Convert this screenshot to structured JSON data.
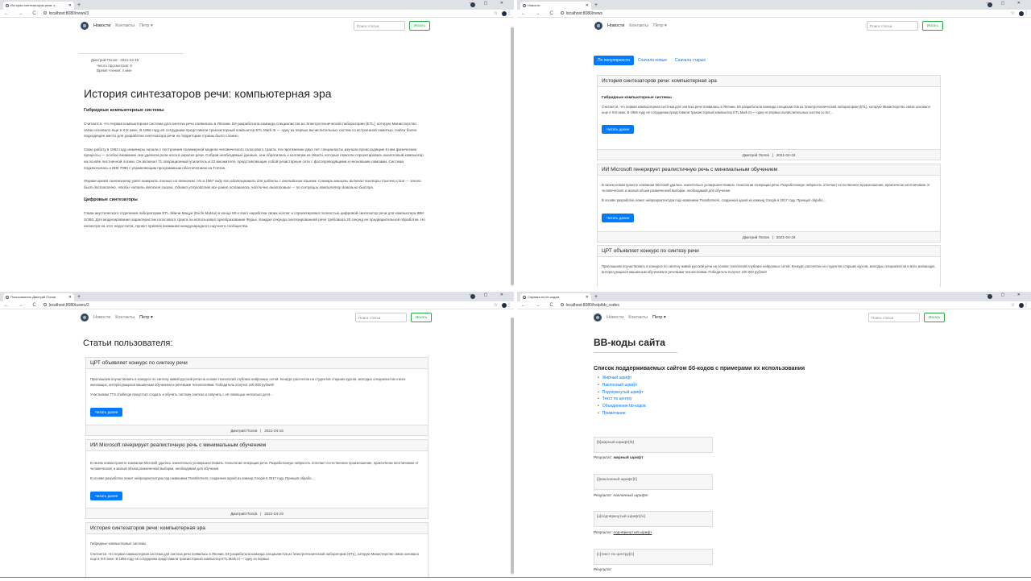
{
  "windows": [
    {
      "tab_title": "История синтезаторов речи: к...",
      "url": "localhost:8080/news/3",
      "nav": {
        "news": "Новости",
        "contacts": "Контакты",
        "user": "Петр ▾"
      },
      "search_placeholder": "Поиск статьи",
      "search_btn": "Искать",
      "meta": {
        "author": "Дмитрий Попов",
        "date": "2021-04-18",
        "views": "Число просмотров: 8",
        "reading": "Время чтения: 4 мин"
      },
      "article": {
        "title": "История синтезаторов речи: компьютерная эра",
        "h1": "Гибридные компьютерные системы",
        "p1": "Считается, что первая компьютерная система для синтеза речи появилась в Японии. Её разработала команда специалистов из Электротехнической лаборатории (ETL), которую Министерство связи основало еще в XIX веке. В 1956 году её сотрудники представили транзисторный компьютер ETL Mark III — одну из первых вычислительных систем со встроенной памятью. Найти более подходящее место для разработки синтезатора речи на территории страны было сложно.",
        "p2": "Свою работу в 1963 году инженеры начали с построения полимерной модели человеческого голосового тракта. На протяжении двух лет специалисты изучали происходящие в нем физические процессы — особое внимание они уделили роли носа в окраске речи. Собрав необходимые данные, они обратились к коллегам из Hitachi, которые помогли спроектировать аналоговый компьютер на основе лестничной логики. Он включал 71 операционный усилитель и 22 множителя, представляющие собой резисторные сети с фотопроводящими и неоновыми лампами. Система подключалась к IBM 7090 с управляющим программным обеспечением на Fortran.",
        "p3": "Первое время синтезатор умел говорить только на японском. Но в 1967 году его адаптировали для работы с английским языком. Словарь машины включал полторы тысячи слов — этого было достаточно, чтобы читать детские сказки. Однако устройство все равно оставалось частично аналоговым — по ситуации компилятор довольно быстро.",
        "h2": "Цифровые синтезаторы",
        "p4": "Глава акустического отделения лаборатории ETL Эйичи Мацуи (Eiichi Matsui) в конце 60-х взял наработки своих коллег и спроектировал полностью цифровой синтезатор речи для компьютера IBM S/360. Для моделирования характеристик голосового тракта он использовал преобразование Фурье. Каждая секунда синтезированной речи требовала 20 секунд ее предварительной обработки. Но несмотря на этот недостаток, проект превлек внимание международного научного сообщества."
      }
    },
    {
      "tab_title": "Новости",
      "url": "localhost:8080/news",
      "nav": {
        "news": "Новости",
        "contacts": "Контакты",
        "user": "Петр ▾"
      },
      "search_placeholder": "Поиск статьи",
      "search_btn": "Искать",
      "sort": [
        "По популярности",
        "Сначала новые",
        "Сначала старые"
      ],
      "read_more": "Читать далее",
      "cards": [
        {
          "title": "История синтезаторов речи: компьютерная эра",
          "sub": "Гибридные компьютерные системы",
          "text": "Считается, что первая компьютерная система для синтеза речи появилась в Японии. Её разработала команда специалистов из Электротехнической лаборатории (ETL), которую Министерство связи основало еще в XIX веке. В 1956 году её сотрудники представили транзисторный компьютер ETL Mark III — одну из первых вычислительных систем со вст...",
          "author": "Дмитрий Попов",
          "date": "2021-04-18"
        },
        {
          "title": "ИИ Microsoft генерирует реалистичную речь с минимальным обучением",
          "text": "В своем новом проекте компании Microsoft удалось значительно усовершенствовать технологии генерации речи. Разработанную нейросеть отличает естественное произношение, практически неотличимое от человеческой, и малый объем размеченной выборки, необходимой для обучения.",
          "text2": "В основе разработки лежит нейроархитектура под названием Transformers, созданная одной из команд Google в 2017 году. Принцип обрабо...",
          "author": "Дмитрий Попов",
          "date": "2021-04-19"
        },
        {
          "title": "ЦРТ объявляет конкурс по синтезу речи",
          "text": "Приглашаем поучаствовать в конкурсе по синтезу живой русской речи на основе технологий глубоких нейронных сетей. Конкурс рассчитан на студентов старших курсов, молодых специалистов и всех желающих, интересующихся машинным обучением и речевыми технологиями. Победитель получит 100 000 рублей!"
        }
      ]
    },
    {
      "tab_title": "Пользователь Дмитрий Попов",
      "url": "localhost:8080/users/2",
      "nav": {
        "news": "Новости",
        "contacts": "Контакты",
        "user": "Петр ▾"
      },
      "search_placeholder": "Поиск статьи",
      "search_btn": "Искать",
      "heading": "Статьи пользователя:",
      "read_more": "Читать далее",
      "cards": [
        {
          "title": "ЦРТ объявляет конкурс по синтезу речи",
          "text": "Приглашаем поучаствовать в конкурсе по синтезу живой русской речи на основе технологий глубоких нейронных сетей. Конкурс рассчитан на студентов старших курсов, молодых специалистов и всех желающих, интересующихся машинным обучением и речевыми технологиями. Победитель получит 100 000 рублей!",
          "text2": "Участникам TTS challenge предстоит создать и обучить систему синтеза и озвучить с её помощью несколько деся...",
          "author": "Дмитрий Попов",
          "date": "2021-04-15"
        },
        {
          "title": "ИИ Microsoft генерирует реалистичную речь с минимальным обучением",
          "text": "В своем новом проекте компании Microsoft удалось значительно усовершенствовать технологии генерации речи. Разработанную нейросеть отличает естественное произношение, практически неотличимое от человеческой, и малый объем размеченной выборки, необходимой для обучения.",
          "text2": "В основе разработки лежит нейроархитектура под названием Transformers, созданная одной из команд Google в 2017 году. Принцип обрабо...",
          "author": "Дмитрий Попов",
          "date": "2021-04-19"
        },
        {
          "title": "История синтезаторов речи: компьютерная эра",
          "sub": "Гибридные компьютерные системы",
          "text": "Считается, что первая компьютерная система для синтеза речи появилась в Японии. Её разработала команда специалистов из Электротехнической лаборатории (ETL), которую Министерство связи основало еще в XIX веке. В 1956 году её сотрудники представили транзисторный компьютер ETL Mark III — одну из первых"
        }
      ]
    },
    {
      "tab_title": "Справка по bb-кодам",
      "url": "localhost:8080/help/bb_codes",
      "nav": {
        "news": "Новости",
        "contacts": "Контакты",
        "user": "Петр ▾"
      },
      "search_placeholder": "Поиск статьи",
      "search_btn": "Искать",
      "title": "BB-коды сайта",
      "subtitle": "Список поддерживаемых сайтом бб-кодов с примерами их использования",
      "list": [
        "Жирный шрифт",
        "Наклонный шрифт",
        "Подчёркнутый шрифт",
        "Текст по центру",
        "Объединение bb-кодов",
        "Примечание"
      ],
      "examples": [
        {
          "code": "[b]жирный шрифт[/b]",
          "result_label": "Результат:",
          "result": "жирный шрифт"
        },
        {
          "code": "[i]наклонный шрифт[/i]",
          "result_label": "Результат:",
          "result": "наклонный шрифт"
        },
        {
          "code": "[u]подчёркнутый шрифт[/u]",
          "result_label": "Результат:",
          "result": "подчёркнутый шрифт"
        },
        {
          "code": "[c]текст по центру[/c]",
          "result_label": "Результат:",
          "result": ""
        }
      ]
    }
  ],
  "colors": {
    "primary": "#007bff",
    "success": "#28a745",
    "tabbar": "#dee1e6"
  }
}
